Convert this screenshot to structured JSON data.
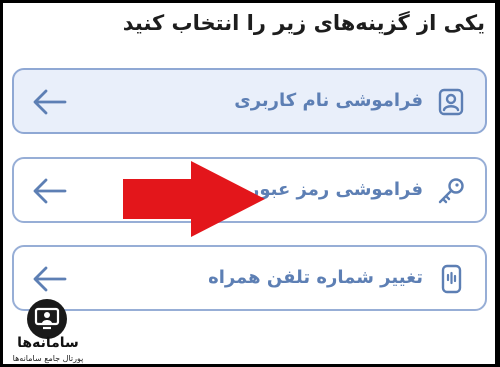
{
  "heading": "یکی از گزینه‌های زیر را انتخاب کنید",
  "options": [
    {
      "label": "فراموشی نام کاربری",
      "icon": "user-id-icon",
      "arrow_icon": "arrow-left-icon",
      "state": "selected"
    },
    {
      "label": "فراموشی رمز عبور",
      "icon": "key-icon",
      "arrow_icon": "arrow-left-icon",
      "state": "default"
    },
    {
      "label": "تغییر شماره تلفن همراه",
      "icon": "phone-icon",
      "arrow_icon": "arrow-left-icon",
      "state": "default"
    }
  ],
  "annotation": {
    "icon": "red-pointer-arrow-icon",
    "color": "#e3161b"
  },
  "watermark": {
    "title": "سامانه‌ها",
    "subtitle": "پورتال جامع سامانه‌ها"
  },
  "colors": {
    "accent": "#5d7fb4",
    "border": "#97aed6",
    "selected_bg": "#e9effa"
  }
}
